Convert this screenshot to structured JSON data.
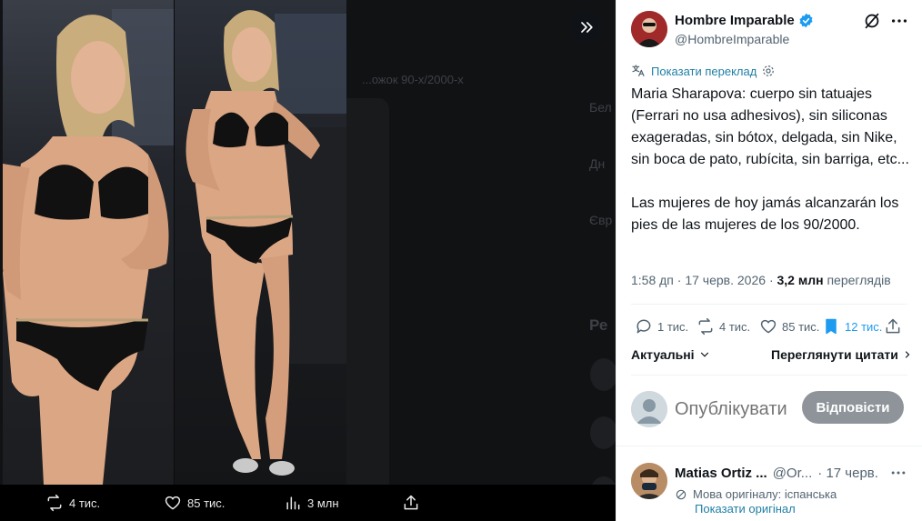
{
  "media": {
    "background_text": "...ожок 90-х/2000-х",
    "side_labels": [
      "Бел",
      "Дн",
      "Євр",
      "Ре"
    ],
    "toolbar": {
      "retweets": "4 тис.",
      "likes": "85 тис.",
      "views": "3 млн"
    }
  },
  "tweet": {
    "author_name": "Hombre Imparable",
    "author_handle": "@HombreImparable",
    "translate_label": "Показати переклад",
    "text": "Maria Sharapova: cuerpo sin tatuajes (Ferrari no usa adhesivos), sin siliconas exageradas, sin bótox, delgada, sin Nike, sin boca de pato, rubícita, sin barriga, etc...\n\nLas mujeres de hoy jamás alcanzarán los pies de las mujeres de los 90/2000.",
    "time": "1:58 дп",
    "date": "17 черв. 2026",
    "views_count": "3,2 млн",
    "views_label": "переглядів",
    "actions": {
      "replies": "1 тис.",
      "retweets": "4 тис.",
      "likes": "85 тис.",
      "bookmarks": "12 тис."
    },
    "sort_label": "Актуальні",
    "quotes_label": "Переглянути цитати"
  },
  "reply_box": {
    "placeholder": "Опублікувати відповідь",
    "button_label": "Відповісти"
  },
  "reply": {
    "name": "Matias Ortiz ...",
    "handle": "@Or...",
    "date": "· 17 черв.",
    "orig_lang": "Мова оригіналу: іспанська",
    "show_original": "Показати оригінал"
  },
  "colors": {
    "accent": "#1d9bf0",
    "verified": "#1d9bf0",
    "link": "#1d7fa5",
    "muted": "#536471",
    "button_disabled": "#8e9499"
  }
}
